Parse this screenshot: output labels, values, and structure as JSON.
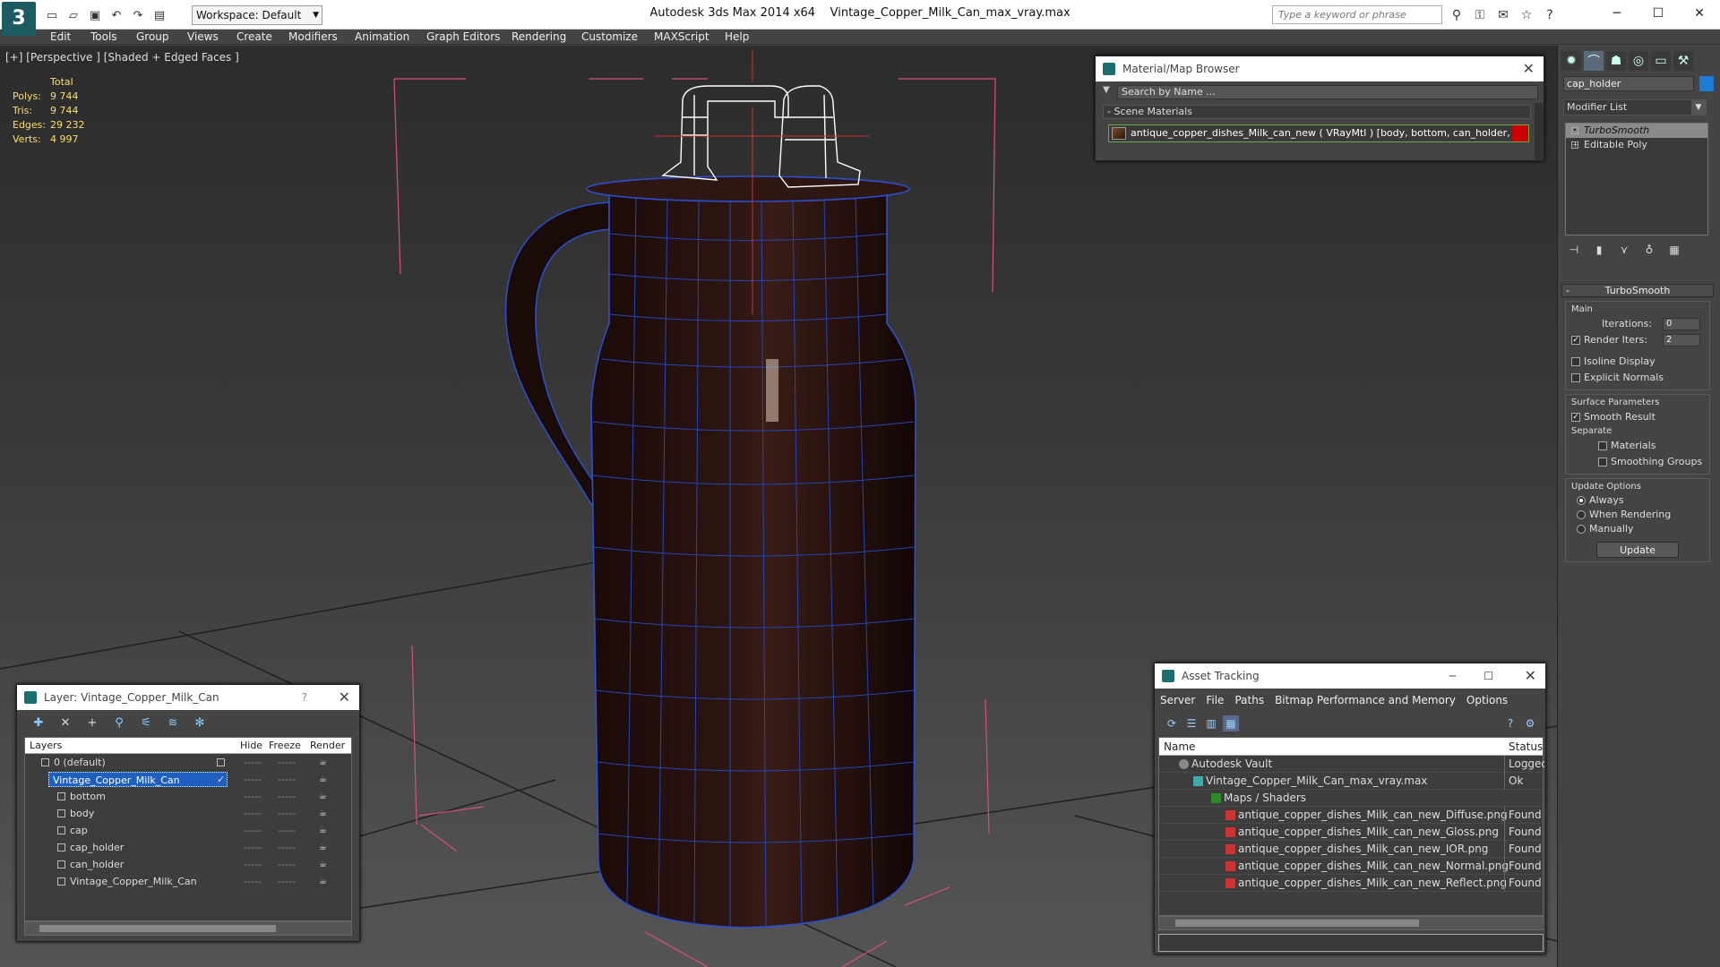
{
  "title": {
    "app": "Autodesk 3ds Max  2014 x64",
    "file": "Vintage_Copper_Milk_Can_max_vray.max",
    "workspace": "Workspace: Default",
    "search_placeholder": "Type a keyword or phrase"
  },
  "menu": [
    "Edit",
    "Tools",
    "Group",
    "Views",
    "Create",
    "Modifiers",
    "Animation",
    "Graph Editors",
    "Rendering",
    "Customize",
    "MAXScript",
    "Help"
  ],
  "viewport": {
    "label": "[+] [Perspective ] [Shaded + Edged Faces ]",
    "stats_header": "Total",
    "stats": [
      {
        "k": "Polys:",
        "v": "9 744"
      },
      {
        "k": "Tris:",
        "v": "9 744"
      },
      {
        "k": "Edges:",
        "v": "29 232"
      },
      {
        "k": "Verts:",
        "v": "4 997"
      }
    ]
  },
  "material_browser": {
    "title": "Material/Map Browser",
    "search": "Search by Name ...",
    "section": "- Scene Materials",
    "item": "antique_copper_dishes_Milk_can_new  ( VRayMtl )  [body, bottom, can_holder, cap, c..."
  },
  "command_panel": {
    "object_name": "cap_holder",
    "modifier_list": "Modifier List",
    "stack": [
      "TurboSmooth",
      "Editable Poly"
    ],
    "rollout_title": "TurboSmooth",
    "main_label": "Main",
    "iterations_label": "Iterations:",
    "iterations": "0",
    "render_iters_label": "Render Iters:",
    "render_iters": "2",
    "isoline": "Isoline Display",
    "explicit": "Explicit Normals",
    "surface_label": "Surface Parameters",
    "smooth_result": "Smooth Result",
    "separate_label": "Separate",
    "materials": "Materials",
    "smoothing_groups": "Smoothing Groups",
    "update_options": "Update Options",
    "always": "Always",
    "when_rendering": "When Rendering",
    "manually": "Manually",
    "update_btn": "Update"
  },
  "layer_panel": {
    "title": "Layer: Vintage_Copper_Milk_Can",
    "help": "?",
    "headers": {
      "layers": "Layers",
      "hide": "Hide",
      "freeze": "Freeze",
      "render": "Render"
    },
    "rows": [
      {
        "name": "0 (default)",
        "indent": 0
      },
      {
        "name": "Vintage_Copper_Milk_Can",
        "indent": 0,
        "selected": true
      },
      {
        "name": "bottom",
        "indent": 1
      },
      {
        "name": "body",
        "indent": 1
      },
      {
        "name": "cap",
        "indent": 1
      },
      {
        "name": "cap_holder",
        "indent": 1
      },
      {
        "name": "can_holder",
        "indent": 1
      },
      {
        "name": "Vintage_Copper_Milk_Can",
        "indent": 1
      }
    ],
    "dash": "-----"
  },
  "asset_tracking": {
    "title": "Asset Tracking",
    "menu": [
      "Server",
      "File",
      "Paths",
      "Bitmap Performance and Memory",
      "Options"
    ],
    "headers": {
      "name": "Name",
      "status": "Status"
    },
    "rows": [
      {
        "name": "Autodesk Vault",
        "status": "Logged Out",
        "indent": 1
      },
      {
        "name": "Vintage_Copper_Milk_Can_max_vray.max",
        "status": "Ok",
        "indent": 2
      },
      {
        "name": "Maps / Shaders",
        "status": "",
        "indent": 3
      },
      {
        "name": "antique_copper_dishes_Milk_can_new_Diffuse.png",
        "status": "Found",
        "indent": 4
      },
      {
        "name": "antique_copper_dishes_Milk_can_new_Gloss.png",
        "status": "Found",
        "indent": 4
      },
      {
        "name": "antique_copper_dishes_Milk_can_new_IOR.png",
        "status": "Found",
        "indent": 4
      },
      {
        "name": "antique_copper_dishes_Milk_can_new_Normal.png",
        "status": "Found",
        "indent": 4
      },
      {
        "name": "antique_copper_dishes_Milk_can_new_Reflect.png",
        "status": "Found",
        "indent": 4
      }
    ]
  },
  "colors": {
    "accent": "#1e7bd6",
    "selection": "#1e5fbf",
    "stats": "#ffdd66",
    "wire": "#2a50d0"
  }
}
